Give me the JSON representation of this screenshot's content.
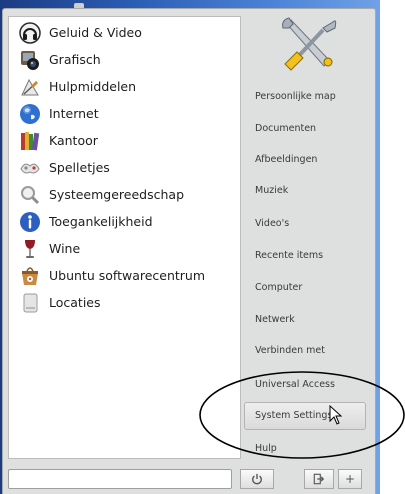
{
  "categories": [
    {
      "label": "Geluid & Video",
      "icon": "headphones-icon"
    },
    {
      "label": "Grafisch",
      "icon": "camera-icon"
    },
    {
      "label": "Hulpmiddelen",
      "icon": "calculator-icon"
    },
    {
      "label": "Internet",
      "icon": "globe-icon"
    },
    {
      "label": "Kantoor",
      "icon": "books-icon"
    },
    {
      "label": "Spelletjes",
      "icon": "cards-icon"
    },
    {
      "label": "Systeemgereedschap",
      "icon": "magnifier-icon"
    },
    {
      "label": "Toegankelijkheid",
      "icon": "accessibility-icon"
    },
    {
      "label": "Wine",
      "icon": "wine-glass-icon"
    },
    {
      "label": "Ubuntu softwarecentrum",
      "icon": "software-center-icon"
    },
    {
      "label": "Locaties",
      "icon": "drive-icon"
    }
  ],
  "places": [
    {
      "label": "Persoonlijke map"
    },
    {
      "label": "Documenten"
    },
    {
      "label": "Afbeeldingen"
    },
    {
      "label": "Muziek"
    },
    {
      "label": "Video's"
    },
    {
      "label": "Recente items"
    },
    {
      "label": "Computer"
    },
    {
      "label": "Netwerk"
    },
    {
      "label": "Verbinden met"
    },
    {
      "label": "Universal Access"
    },
    {
      "label": "System Settings",
      "hover": true
    },
    {
      "label": "Hulp"
    }
  ],
  "search": {
    "value": ""
  },
  "buttons": {
    "plus_label": "+"
  },
  "colors": {
    "accent_annotation": "#000000",
    "hover_bg": "#e4e4e4"
  }
}
